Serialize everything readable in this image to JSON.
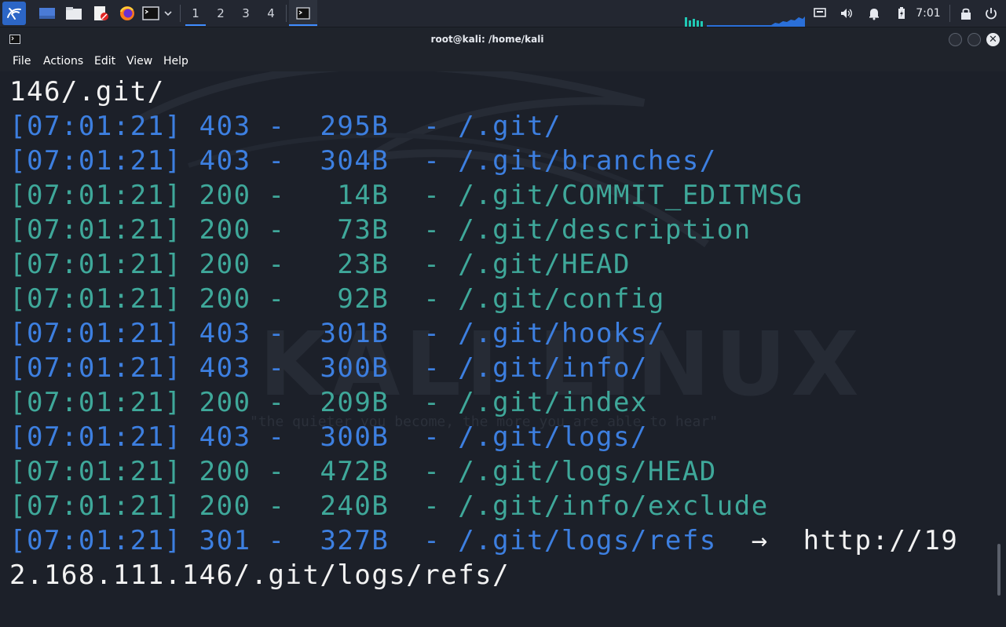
{
  "panel": {
    "workspaces": [
      "1",
      "2",
      "3",
      "4"
    ],
    "active_workspace": "1",
    "clock": "7:01"
  },
  "window": {
    "title": "root@kali: /home/kali"
  },
  "menu": [
    "File",
    "Actions",
    "Edit",
    "View",
    "Help"
  ],
  "terminal": {
    "lines": [
      {
        "text": "146/.git/",
        "color": "white"
      },
      {
        "text": "[07:01:21] 403 -  295B  - /.git/",
        "color": "blue"
      },
      {
        "text": "[07:01:21] 403 -  304B  - /.git/branches/",
        "color": "blue"
      },
      {
        "text": "[07:01:21] 200 -   14B  - /.git/COMMIT_EDITMSG",
        "color": "green"
      },
      {
        "text": "[07:01:21] 200 -   73B  - /.git/description",
        "color": "green"
      },
      {
        "text": "[07:01:21] 200 -   23B  - /.git/HEAD",
        "color": "green"
      },
      {
        "text": "[07:01:21] 200 -   92B  - /.git/config",
        "color": "green"
      },
      {
        "text": "[07:01:21] 403 -  301B  - /.git/hooks/",
        "color": "blue"
      },
      {
        "text": "[07:01:21] 403 -  300B  - /.git/info/",
        "color": "blue"
      },
      {
        "text": "[07:01:21] 200 -  209B  - /.git/index",
        "color": "green"
      },
      {
        "text": "[07:01:21] 403 -  300B  - /.git/logs/",
        "color": "blue"
      },
      {
        "text": "[07:01:21] 200 -  472B  - /.git/logs/HEAD",
        "color": "green"
      },
      {
        "text": "[07:01:21] 200 -  240B  - /.git/info/exclude",
        "color": "green"
      },
      {
        "text": "[07:01:21] 301 -  327B  - /.git/logs/refs",
        "color": "blue",
        "suffix": "  →  http://19",
        "suffix_color": "white"
      },
      {
        "text": "2.168.111.146/.git/logs/refs/",
        "color": "white"
      }
    ]
  },
  "watermark": {
    "logo_text": "KALI LINUX",
    "tagline": "\"the quieter you become, the more you are able to hear\""
  },
  "colors": {
    "white": "#f2f2f2",
    "blue": "#3d7fe0",
    "green": "#3fa89a",
    "panel_bg": "#232731",
    "terminal_bg": "#1c2029",
    "accent": "#3f8cff"
  }
}
